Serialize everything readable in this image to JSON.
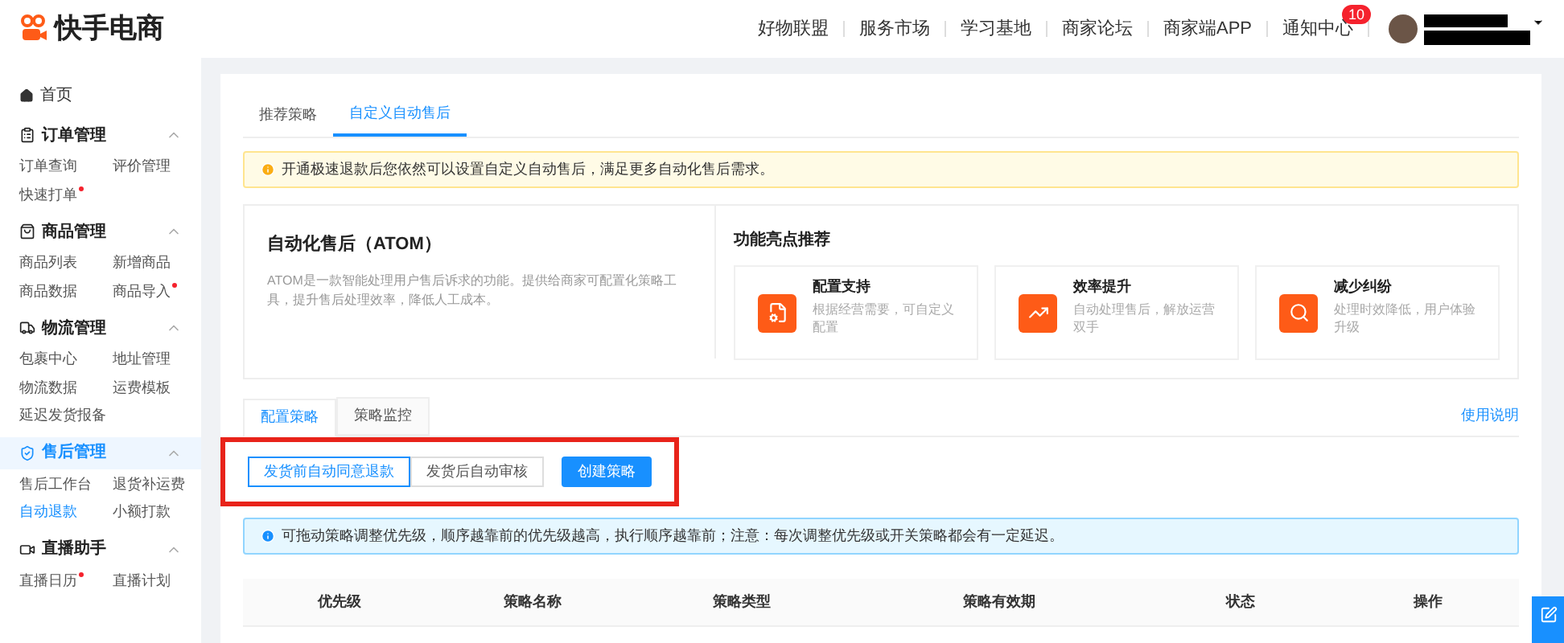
{
  "header": {
    "logo": "快手电商",
    "nav": [
      "好物联盟",
      "服务市场",
      "学习基地",
      "商家论坛",
      "商家端APP"
    ],
    "notice": {
      "label": "通知中心",
      "badge": "10"
    }
  },
  "sidebar": {
    "home": "首页",
    "groups": [
      {
        "title": "订单管理",
        "expanded": true,
        "active": false,
        "items": [
          {
            "label": "订单查询",
            "selected": false,
            "dot": false
          },
          {
            "label": "评价管理",
            "selected": false,
            "dot": false
          },
          {
            "label": "快速打单",
            "selected": false,
            "dot": true
          }
        ]
      },
      {
        "title": "商品管理",
        "expanded": true,
        "active": false,
        "items": [
          {
            "label": "商品列表",
            "selected": false,
            "dot": false
          },
          {
            "label": "新增商品",
            "selected": false,
            "dot": false
          },
          {
            "label": "商品数据",
            "selected": false,
            "dot": false
          },
          {
            "label": "商品导入",
            "selected": false,
            "dot": true
          }
        ]
      },
      {
        "title": "物流管理",
        "expanded": true,
        "active": false,
        "items": [
          {
            "label": "包裹中心",
            "selected": false,
            "dot": false
          },
          {
            "label": "地址管理",
            "selected": false,
            "dot": false
          },
          {
            "label": "物流数据",
            "selected": false,
            "dot": false
          },
          {
            "label": "运费模板",
            "selected": false,
            "dot": false
          },
          {
            "label": "延迟发货报备",
            "selected": false,
            "dot": false
          }
        ]
      },
      {
        "title": "售后管理",
        "expanded": true,
        "active": true,
        "items": [
          {
            "label": "售后工作台",
            "selected": false,
            "dot": false
          },
          {
            "label": "退货补运费",
            "selected": false,
            "dot": false
          },
          {
            "label": "自动退款",
            "selected": true,
            "dot": false
          },
          {
            "label": "小额打款",
            "selected": false,
            "dot": false
          }
        ]
      },
      {
        "title": "直播助手",
        "expanded": true,
        "active": false,
        "items": [
          {
            "label": "直播日历",
            "selected": false,
            "dot": true
          },
          {
            "label": "直播计划",
            "selected": false,
            "dot": false
          }
        ]
      }
    ]
  },
  "tabs": [
    {
      "label": "推荐策略",
      "selected": false
    },
    {
      "label": "自定义自动售后",
      "selected": true
    }
  ],
  "warning": "开通极速退款后您依然可以设置自定义自动售后，满足更多自动化售后需求。",
  "intro": {
    "title": "自动化售后（ATOM）",
    "text": "ATOM是一款智能处理用户售后诉求的功能。提供给商家可配置化策略工具，提升售后处理效率，降低人工成本。"
  },
  "features": {
    "title": "功能亮点推荐",
    "items": [
      {
        "kind": "config",
        "title": "配置支持",
        "text": "根据经营需要，可自定义配置"
      },
      {
        "kind": "chart",
        "title": "效率提升",
        "text": "自动处理售后，解放运营双手"
      },
      {
        "kind": "search",
        "title": "减少纠纷",
        "text": "处理时效降低，用户体验升级"
      }
    ]
  },
  "subtabs": [
    {
      "label": "配置策略",
      "selected": true
    },
    {
      "label": "策略监控",
      "selected": false
    }
  ],
  "help_link": "使用说明",
  "strategy_buttons": {
    "highlighted": true,
    "options": [
      {
        "label": "发货前自动同意退款",
        "selected": true
      },
      {
        "label": "发货后自动审核",
        "selected": false
      }
    ],
    "create": "创建策略"
  },
  "info": "可拖动策略调整优先级，顺序越靠前的优先级越高，执行顺序越靠前；注意：每次调整优先级或开关策略都会有一定延迟。",
  "table": {
    "columns": [
      "优先级",
      "策略名称",
      "策略类型",
      "策略有效期",
      "状态",
      "操作"
    ]
  }
}
